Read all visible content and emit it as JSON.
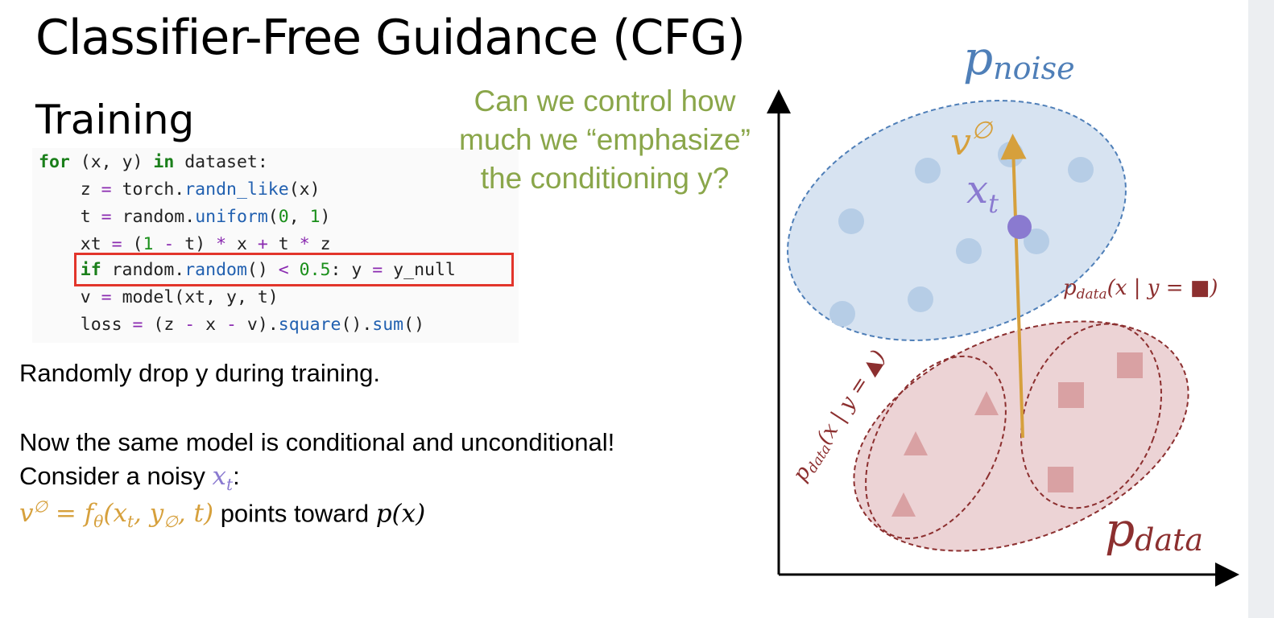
{
  "slide": {
    "title": "Classifier-Free Guidance (CFG)",
    "subtitle": "Training"
  },
  "code": {
    "line1": {
      "kw1": "for",
      "a": " (x, y) ",
      "kw2": "in",
      "b": " dataset:"
    },
    "line2": {
      "a": "    z ",
      "op": "=",
      "b": " torch.",
      "fn": "randn_like",
      "c": "(x)"
    },
    "line3": {
      "a": "    t ",
      "op": "=",
      "b": " random.",
      "fn": "uniform",
      "c": "(",
      "n1": "0",
      "d": ", ",
      "n2": "1",
      "e": ")"
    },
    "line4": {
      "a": "    xt ",
      "op1": "=",
      "b": " (",
      "n1": "1",
      "c": " ",
      "op2": "-",
      "d": " t) ",
      "op3": "*",
      "e": " x ",
      "op4": "+",
      "f": " t ",
      "op5": "*",
      "g": " z"
    },
    "line5": {
      "a": "    ",
      "kw": "if",
      "b": " random.",
      "fn": "random",
      "c": "() ",
      "op1": "<",
      "d": " ",
      "n": "0.5",
      "e": ": y ",
      "op2": "=",
      "f": " y_null"
    },
    "line6": {
      "a": "    v ",
      "op": "=",
      "b": " model(xt, y, t)"
    },
    "line7": {
      "a": "    loss ",
      "op1": "=",
      "b": " (z ",
      "op2": "-",
      "c": " x ",
      "op3": "-",
      "d": " v).",
      "fn1": "square",
      "e": "().",
      "fn2": "sum",
      "f": "()"
    }
  },
  "question": "Can we control how much we “emphasize” the conditioning y?",
  "text": {
    "drop": "Randomly drop y during training.",
    "same_model": "Now the same model is conditional and unconditional!",
    "consider": "Consider a noisy ",
    "x_t": "x",
    "t_sub": "t",
    "colon": ":",
    "v": "v",
    "empty": "∅",
    "equals": " = f",
    "theta": "θ",
    "args_open": "(x",
    "comma": ", y",
    "args_close": ", t)",
    "points": " points toward ",
    "p_x": "p(x)"
  },
  "diagram": {
    "p_noise": "p",
    "noise_sub": "noise",
    "p_data": "p",
    "data_sub": "data",
    "v_label": "v",
    "v_sup": "∅",
    "xt_label": "x",
    "xt_sub": "t",
    "cond_square": "(x | y = ■)",
    "cond_triangle": "(x | y = ▲)",
    "colors": {
      "noise": "#4f7fb8",
      "noise_fill": "#d7e3f1",
      "noise_dot": "#b6cde6",
      "data": "#8c2f2f",
      "data_fill": "#ecd3d5",
      "data_mark": "#d9a1a3",
      "arrow": "#d6a03c",
      "point": "#8a7ad0",
      "question": "#8aa64a"
    }
  }
}
